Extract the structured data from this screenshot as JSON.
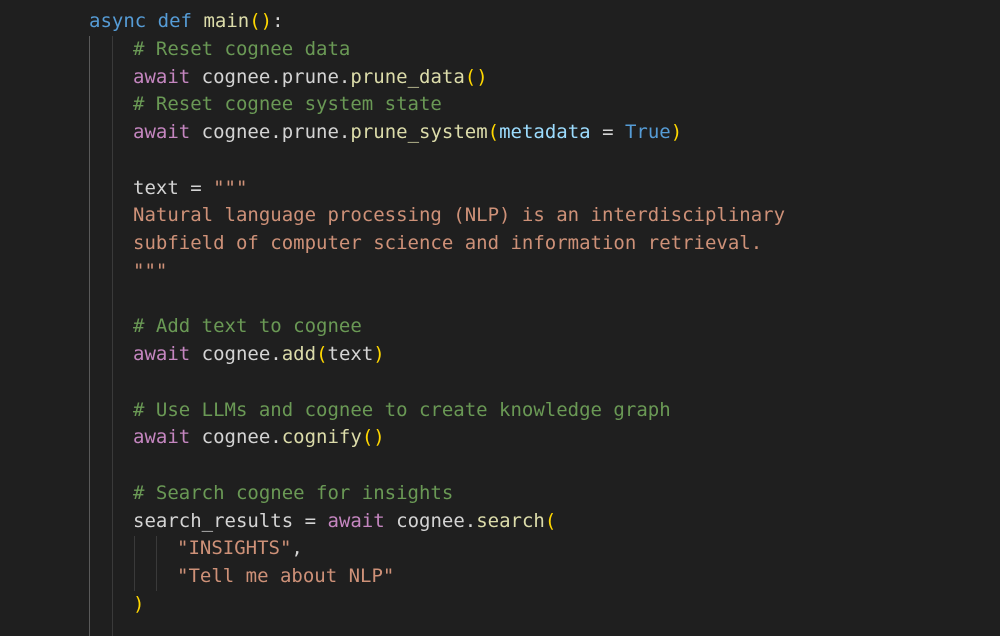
{
  "editor": {
    "colors": {
      "background": "#1f1f1f",
      "keyword": "#569cd6",
      "control": "#c586c0",
      "function": "#dcdcaa",
      "string": "#ce9178",
      "comment": "#6a9955",
      "parameter": "#9cdcfe",
      "bracket": "#ffd700"
    },
    "lines": [
      {
        "indent": 0,
        "tokens": [
          {
            "t": "kw",
            "v": "async"
          },
          {
            "t": "op",
            "v": " "
          },
          {
            "t": "kw",
            "v": "def"
          },
          {
            "t": "op",
            "v": " "
          },
          {
            "t": "fn",
            "v": "main"
          },
          {
            "t": "br",
            "v": "()"
          },
          {
            "t": "op",
            "v": ":"
          }
        ]
      },
      {
        "indent": 1,
        "tokens": [
          {
            "t": "com",
            "v": "# Reset cognee data"
          }
        ]
      },
      {
        "indent": 1,
        "tokens": [
          {
            "t": "ctl",
            "v": "await"
          },
          {
            "t": "op",
            "v": " "
          },
          {
            "t": "id",
            "v": "cognee.prune."
          },
          {
            "t": "fn",
            "v": "prune_data"
          },
          {
            "t": "br",
            "v": "()"
          }
        ]
      },
      {
        "indent": 1,
        "tokens": [
          {
            "t": "com",
            "v": "# Reset cognee system state"
          }
        ]
      },
      {
        "indent": 1,
        "tokens": [
          {
            "t": "ctl",
            "v": "await"
          },
          {
            "t": "op",
            "v": " "
          },
          {
            "t": "id",
            "v": "cognee.prune."
          },
          {
            "t": "fn",
            "v": "prune_system"
          },
          {
            "t": "br",
            "v": "("
          },
          {
            "t": "param",
            "v": "metadata"
          },
          {
            "t": "op",
            "v": " = "
          },
          {
            "t": "const",
            "v": "True"
          },
          {
            "t": "br",
            "v": ")"
          }
        ]
      },
      {
        "indent": 1,
        "tokens": []
      },
      {
        "indent": 1,
        "tokens": [
          {
            "t": "id",
            "v": "text"
          },
          {
            "t": "op",
            "v": " = "
          },
          {
            "t": "str",
            "v": "\"\"\""
          }
        ]
      },
      {
        "indent": 1,
        "tokens": [
          {
            "t": "str",
            "v": "Natural language processing (NLP) is an interdisciplinary"
          }
        ]
      },
      {
        "indent": 1,
        "tokens": [
          {
            "t": "str",
            "v": "subfield of computer science and information retrieval."
          }
        ]
      },
      {
        "indent": 1,
        "tokens": [
          {
            "t": "str",
            "v": "\"\"\""
          }
        ]
      },
      {
        "indent": 1,
        "tokens": []
      },
      {
        "indent": 1,
        "tokens": [
          {
            "t": "com",
            "v": "# Add text to cognee"
          }
        ]
      },
      {
        "indent": 1,
        "tokens": [
          {
            "t": "ctl",
            "v": "await"
          },
          {
            "t": "op",
            "v": " "
          },
          {
            "t": "id",
            "v": "cognee."
          },
          {
            "t": "fn",
            "v": "add"
          },
          {
            "t": "br",
            "v": "("
          },
          {
            "t": "id",
            "v": "text"
          },
          {
            "t": "br",
            "v": ")"
          }
        ]
      },
      {
        "indent": 1,
        "tokens": []
      },
      {
        "indent": 1,
        "tokens": [
          {
            "t": "com",
            "v": "# Use LLMs and cognee to create knowledge graph"
          }
        ]
      },
      {
        "indent": 1,
        "tokens": [
          {
            "t": "ctl",
            "v": "await"
          },
          {
            "t": "op",
            "v": " "
          },
          {
            "t": "id",
            "v": "cognee."
          },
          {
            "t": "fn",
            "v": "cognify"
          },
          {
            "t": "br",
            "v": "()"
          }
        ]
      },
      {
        "indent": 1,
        "tokens": []
      },
      {
        "indent": 1,
        "tokens": [
          {
            "t": "com",
            "v": "# Search cognee for insights"
          }
        ]
      },
      {
        "indent": 1,
        "tokens": [
          {
            "t": "id",
            "v": "search_results"
          },
          {
            "t": "op",
            "v": " = "
          },
          {
            "t": "ctl",
            "v": "await"
          },
          {
            "t": "op",
            "v": " "
          },
          {
            "t": "id",
            "v": "cognee."
          },
          {
            "t": "fn",
            "v": "search"
          },
          {
            "t": "br",
            "v": "("
          }
        ]
      },
      {
        "indent": 2,
        "tokens": [
          {
            "t": "str",
            "v": "\"INSIGHTS\""
          },
          {
            "t": "op",
            "v": ","
          }
        ]
      },
      {
        "indent": 2,
        "tokens": [
          {
            "t": "str",
            "v": "\"Tell me about NLP\""
          }
        ]
      },
      {
        "indent": 1,
        "tokens": [
          {
            "t": "br",
            "v": ")"
          }
        ]
      },
      {
        "indent": 1,
        "tokens": []
      }
    ]
  }
}
